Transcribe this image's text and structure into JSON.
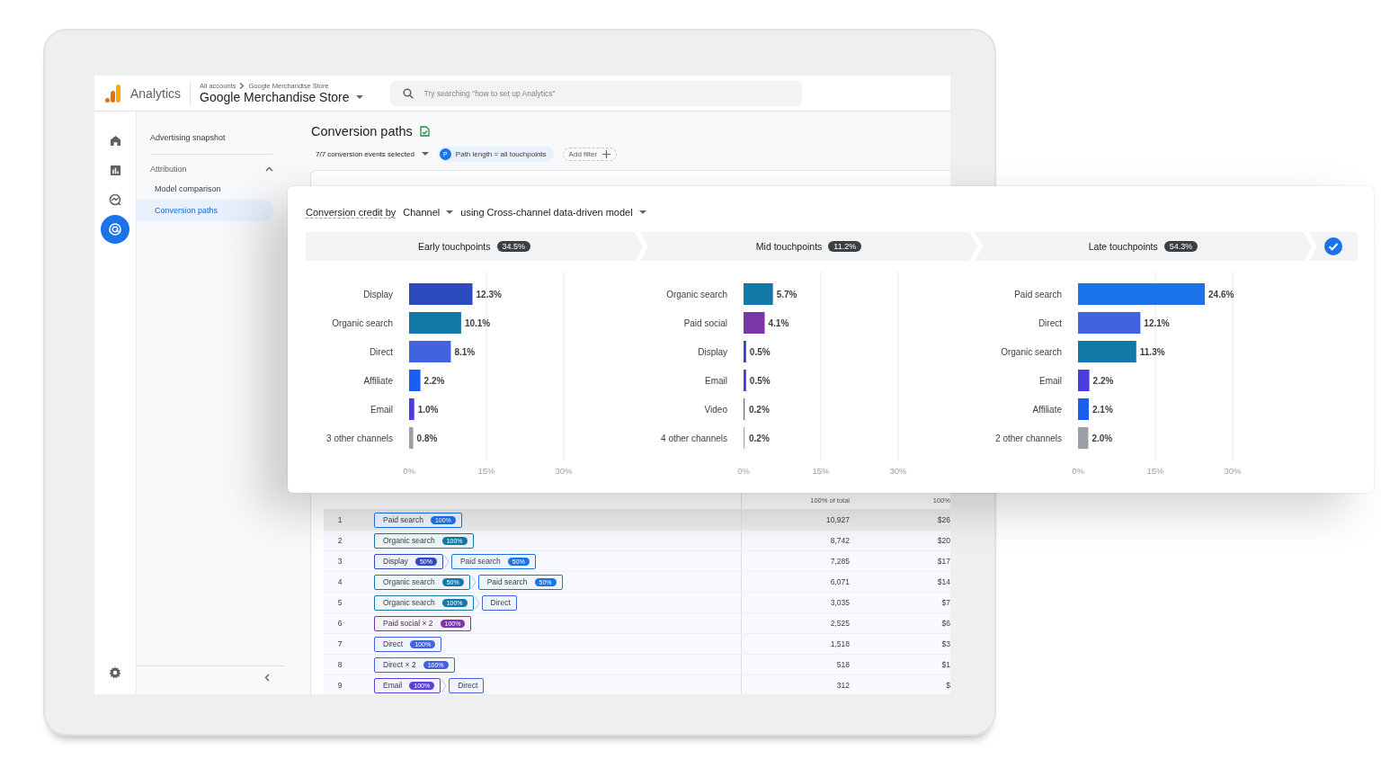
{
  "app": {
    "name": "Analytics"
  },
  "breadcrumb": [
    "All accounts",
    "Google Merchandise Store"
  ],
  "property": "Google Merchandise Store",
  "search": {
    "placeholder": "Try searching \"how to set up Analytics\""
  },
  "rail": [
    {
      "kind": "home",
      "selected": false
    },
    {
      "kind": "reports",
      "selected": false
    },
    {
      "kind": "explore",
      "selected": false
    },
    {
      "kind": "advertising",
      "selected": true
    }
  ],
  "sidebar": {
    "items": [
      {
        "label": "Advertising snapshot",
        "selected": false
      }
    ],
    "sections": [
      {
        "label": "Attribution",
        "expanded": true,
        "items": [
          {
            "label": "Model comparison",
            "selected": false
          },
          {
            "label": "Conversion paths",
            "selected": true
          }
        ]
      }
    ]
  },
  "page": {
    "title": "Conversion paths",
    "events": "7/7 conversion events selected",
    "chip_letter": "P",
    "chip": "Path length = all touchpoints",
    "add_filter": "Add filter"
  },
  "popover": {
    "credit_prefix": "Conversion credit by",
    "dimension": "Channel",
    "model": "using Cross-channel data-driven model",
    "stages": [
      {
        "label": "Early touchpoints",
        "share": "34.5%"
      },
      {
        "label": "Mid touchpoints",
        "share": "11.2%"
      },
      {
        "label": "Late touchpoints",
        "share": "54.3%"
      }
    ],
    "complete": true,
    "charts": [
      {
        "chart_data": {
          "type": "bar",
          "orientation": "horizontal",
          "categories": [
            "Display",
            "Organic search",
            "Direct",
            "Affiliate",
            "Email",
            "3 other channels"
          ],
          "colors": [
            "#2c4bbf",
            "#1379a7",
            "#4263e0",
            "#1a5ff0",
            "#4b3de0",
            "#9aa0a6"
          ],
          "series": [
            {
              "values": [
                12.3,
                10.1,
                8.1,
                2.2,
                1.0,
                0.8
              ]
            }
          ],
          "xlim": [
            0,
            30
          ],
          "xticks": [
            {
              "value": 0,
              "label": "0%"
            },
            {
              "value": 15,
              "label": "15%"
            },
            {
              "value": 30,
              "label": "30%"
            }
          ],
          "value_labels": [
            "12.3%",
            "10.1%",
            "8.1%",
            "2.2%",
            "1.0%",
            "0.8%"
          ]
        }
      },
      {
        "chart_data": {
          "type": "bar",
          "orientation": "horizontal",
          "categories": [
            "Organic search",
            "Paid social",
            "Display",
            "Email",
            "Video",
            "4 other channels"
          ],
          "colors": [
            "#1379a7",
            "#7a35a6",
            "#2c4bbf",
            "#4b3de0",
            "#8a3bc0",
            "#9aa0a6"
          ],
          "series": [
            {
              "values": [
                5.7,
                4.1,
                0.5,
                0.5,
                0.2,
                0.2
              ]
            }
          ],
          "xlim": [
            0,
            30
          ],
          "xticks": [
            {
              "value": 0,
              "label": "0%"
            },
            {
              "value": 15,
              "label": "15%"
            },
            {
              "value": 30,
              "label": "30%"
            }
          ],
          "value_labels": [
            "5.7%",
            "4.1%",
            "0.5%",
            "0.5%",
            "0.2%",
            "0.2%"
          ]
        }
      },
      {
        "chart_data": {
          "type": "bar",
          "orientation": "horizontal",
          "categories": [
            "Paid search",
            "Direct",
            "Organic search",
            "Email",
            "Affiliate",
            "2 other channels"
          ],
          "colors": [
            "#1a73e8",
            "#4263e0",
            "#1379a7",
            "#4b3de0",
            "#1a5ff0",
            "#9aa0a6"
          ],
          "series": [
            {
              "values": [
                24.6,
                12.1,
                11.3,
                2.2,
                2.1,
                2.0
              ]
            }
          ],
          "xlim": [
            0,
            30
          ],
          "xticks": [
            {
              "value": 0,
              "label": "0%"
            },
            {
              "value": 15,
              "label": "15%"
            },
            {
              "value": 30,
              "label": "30%"
            }
          ],
          "value_labels": [
            "24.6%",
            "12.1%",
            "11.3%",
            "2.2%",
            "2.1%",
            "2.0%"
          ]
        }
      }
    ]
  },
  "table": {
    "columns": [
      "100% of total",
      "100%"
    ],
    "rows": [
      {
        "index": "1",
        "selected": true,
        "steps": [
          {
            "label": "Paid search",
            "badge": "100%",
            "color": "#1a73e8"
          }
        ],
        "conversions": "10,927",
        "value": "$26"
      },
      {
        "index": "2",
        "selected": false,
        "steps": [
          {
            "label": "Organic search",
            "badge": "100%",
            "color": "#1379a7"
          }
        ],
        "conversions": "8,742",
        "value": "$20"
      },
      {
        "index": "3",
        "selected": false,
        "steps": [
          {
            "label": "Display",
            "badge": "50%",
            "color": "#2c4bbf"
          },
          {
            "label": "Paid search",
            "badge": "50%",
            "color": "#1a73e8"
          }
        ],
        "conversions": "7,285",
        "value": "$17"
      },
      {
        "index": "4",
        "selected": false,
        "steps": [
          {
            "label": "Organic search",
            "badge": "50%",
            "color": "#1379a7"
          },
          {
            "label": "Paid search",
            "badge": "50%",
            "color": "#1a73e8"
          }
        ],
        "conversions": "6,071",
        "value": "$14"
      },
      {
        "index": "5",
        "selected": false,
        "steps": [
          {
            "label": "Organic search",
            "badge": "100%",
            "color": "#1379a7"
          },
          {
            "label": "Direct",
            "color": "#4263e0"
          }
        ],
        "conversions": "3,035",
        "value": "$7"
      },
      {
        "index": "6",
        "selected": false,
        "steps": [
          {
            "label": "Paid social × 2",
            "badge": "100%",
            "color": "#7a35a6"
          }
        ],
        "conversions": "2,525",
        "value": "$6"
      },
      {
        "index": "7",
        "selected": false,
        "steps": [
          {
            "label": "Direct",
            "badge": "100%",
            "color": "#4263e0"
          }
        ],
        "conversions": "1,518",
        "value": "$3"
      },
      {
        "index": "8",
        "selected": false,
        "steps": [
          {
            "label": "Direct × 2",
            "badge": "100%",
            "color": "#4263e0"
          }
        ],
        "conversions": "518",
        "value": "$1"
      },
      {
        "index": "9",
        "selected": false,
        "steps": [
          {
            "label": "Email",
            "badge": "100%",
            "color": "#5b3fe0"
          },
          {
            "label": "Direct",
            "color": "#4263e0"
          }
        ],
        "conversions": "312",
        "value": "$"
      }
    ]
  }
}
